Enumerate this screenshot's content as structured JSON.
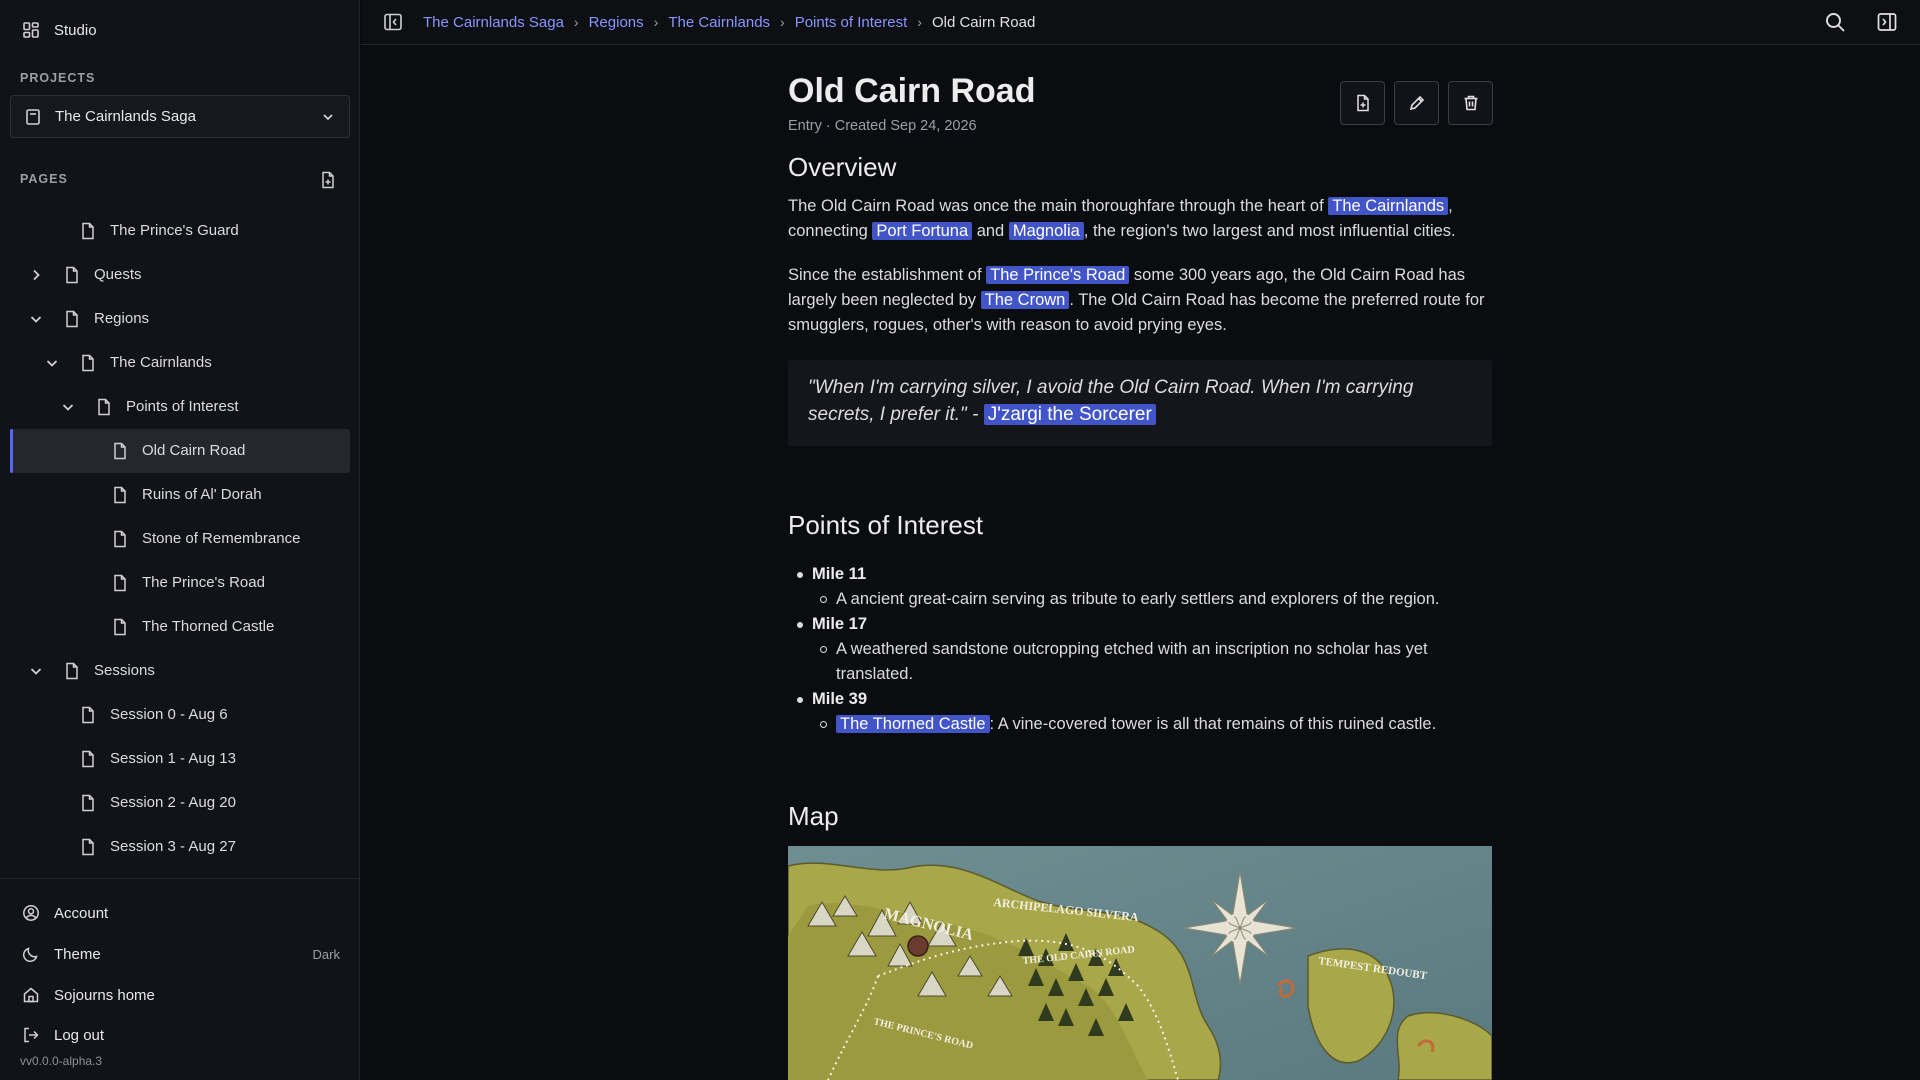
{
  "sidebar": {
    "studio_label": "Studio",
    "projects_label": "PROJECTS",
    "project": "The Cairnlands Saga",
    "pages_label": "PAGES",
    "tree": [
      {
        "label": "The Prince's Guard",
        "depth": 2,
        "toggle": "none",
        "active": false
      },
      {
        "label": "Quests",
        "depth": 1,
        "toggle": "collapsed",
        "active": false
      },
      {
        "label": "Regions",
        "depth": 1,
        "toggle": "expanded",
        "active": false
      },
      {
        "label": "The Cairnlands",
        "depth": 2,
        "toggle": "expanded",
        "active": false
      },
      {
        "label": "Points of Interest",
        "depth": 3,
        "toggle": "expanded",
        "active": false
      },
      {
        "label": "Old Cairn Road",
        "depth": 4,
        "toggle": "none",
        "active": true
      },
      {
        "label": "Ruins of Al' Dorah",
        "depth": 4,
        "toggle": "none",
        "active": false
      },
      {
        "label": "Stone of Remembrance",
        "depth": 4,
        "toggle": "none",
        "active": false
      },
      {
        "label": "The Prince's Road",
        "depth": 4,
        "toggle": "none",
        "active": false
      },
      {
        "label": "The Thorned Castle",
        "depth": 4,
        "toggle": "none",
        "active": false
      },
      {
        "label": "Sessions",
        "depth": 1,
        "toggle": "expanded",
        "active": false
      },
      {
        "label": "Session 0 - Aug 6",
        "depth": 2,
        "toggle": "none",
        "active": false
      },
      {
        "label": "Session 1 - Aug 13",
        "depth": 2,
        "toggle": "none",
        "active": false
      },
      {
        "label": "Session 2 - Aug 20",
        "depth": 2,
        "toggle": "none",
        "active": false
      },
      {
        "label": "Session 3 - Aug 27",
        "depth": 2,
        "toggle": "none",
        "active": false
      }
    ],
    "footer": {
      "account": "Account",
      "theme": "Theme",
      "theme_value": "Dark",
      "home": "Sojourns home",
      "logout": "Log out",
      "version": "vv0.0.0-alpha.3"
    }
  },
  "topbar": {
    "breadcrumb": [
      "The Cairnlands Saga",
      "Regions",
      "The Cairnlands",
      "Points of Interest"
    ],
    "current": "Old Cairn Road"
  },
  "page": {
    "title": "Old Cairn Road",
    "meta": "Entry · Created Sep 24, 2026",
    "overview_heading": "Overview",
    "p1": {
      "t1": "The Old Cairn Road was once the main thoroughfare through the heart of ",
      "m1": "The Cairnlands",
      "t2": ", connecting ",
      "m2": "Port Fortuna",
      "t3": " and ",
      "m3": "Magnolia",
      "t4": ", the region's two largest and most influential cities."
    },
    "p2": {
      "t1": "Since the establishment of ",
      "m1": "The Prince's Road",
      "t2": " some 300 years ago, the Old Cairn Road has largely been neglected by ",
      "m2": "The Crown",
      "t3": ". The Old Cairn Road has become the preferred route for smugglers, rogues, other's with reason to avoid prying eyes."
    },
    "quote": {
      "text": "\"When I'm carrying silver, I avoid the Old Cairn Road. When I'm carrying secrets, I prefer it.\" - ",
      "mention": "J'zargi the Sorcerer"
    },
    "poi_heading": "Points of Interest",
    "poi": {
      "m11": "Mile 11",
      "m11_desc": "A ancient great-cairn serving as tribute to early settlers and explorers of the region.",
      "m17": "Mile 17",
      "m17_desc": "A weathered sandstone outcropping etched with an inscription no scholar has yet translated.",
      "m39": "Mile 39",
      "m39_mention": "The Thorned Castle",
      "m39_desc": ": A vine-covered tower is all that remains of this ruined castle."
    },
    "map_heading": "Map",
    "map_labels": {
      "magnolia": "MAGNOLIA",
      "archipelago": "ARCHIPELAGO SILVERA",
      "old_cairn_road": "THE OLD CAIRN ROAD",
      "tempest": "TEMPEST REDOUBT",
      "princes_road": "THE PRINCE'S ROAD"
    }
  },
  "colors": {
    "accent": "#5865f2",
    "mention_bg": "#4154c8",
    "link": "#8a95ff",
    "background": "#0a0c10",
    "sidebar": "#111318"
  }
}
